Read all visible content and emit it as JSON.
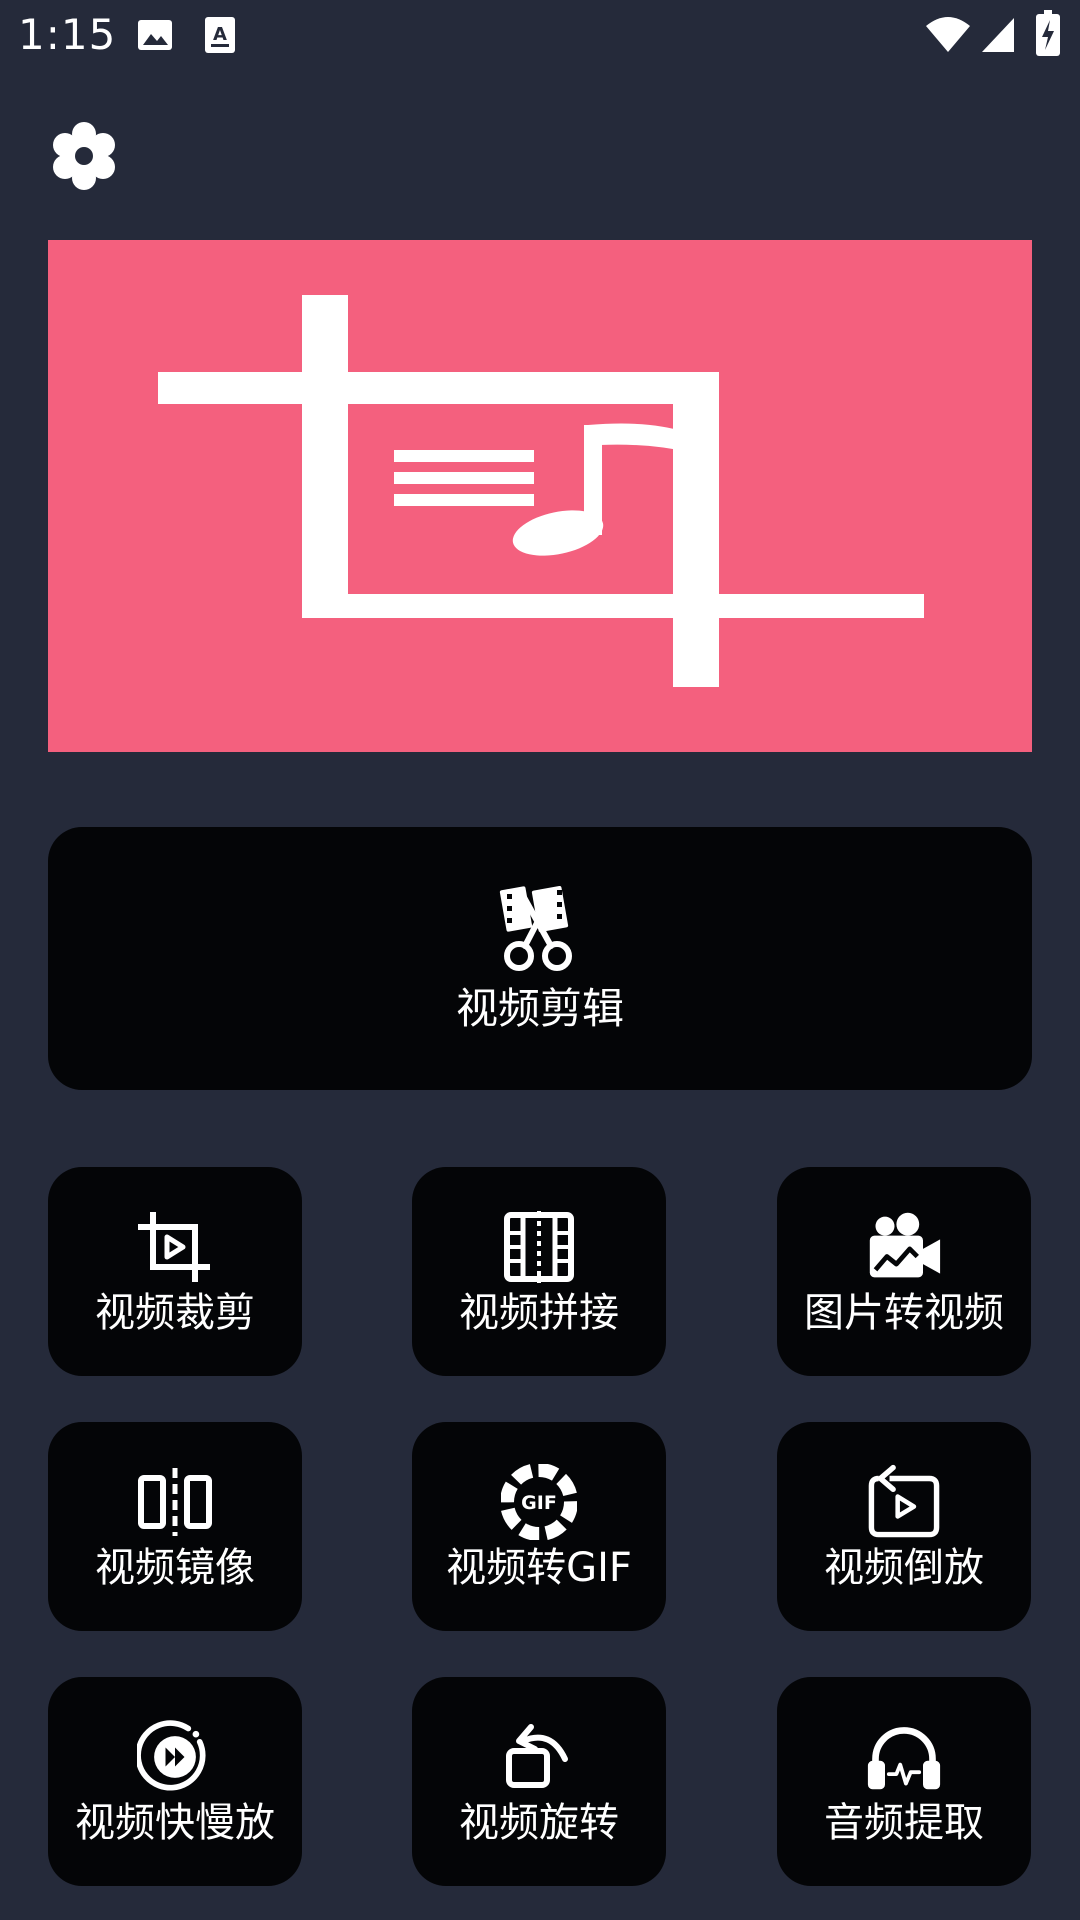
{
  "status_bar": {
    "time": "1:15",
    "icons": [
      "image-icon",
      "accessibility-app-icon",
      "wifi-icon",
      "signal-icon",
      "battery-charging-icon"
    ]
  },
  "header": {
    "settings_icon": "gear-icon"
  },
  "banner": {
    "color": "#f4607e",
    "icon": "crop-music-icon"
  },
  "main": {
    "big_tool": {
      "label": "视频剪辑",
      "icon": "film-scissors-icon"
    },
    "tools": [
      {
        "label": "视频裁剪",
        "icon": "crop-play-icon"
      },
      {
        "label": "视频拼接",
        "icon": "film-join-icon"
      },
      {
        "label": "图片转视频",
        "icon": "picture-camera-icon"
      },
      {
        "label": "视频镜像",
        "icon": "mirror-icon"
      },
      {
        "label": "视频转GIF",
        "icon": "gif-icon"
      },
      {
        "label": "视频倒放",
        "icon": "reverse-play-icon"
      },
      {
        "label": "视频快慢放",
        "icon": "fast-forward-icon"
      },
      {
        "label": "视频旋转",
        "icon": "rotate-icon"
      },
      {
        "label": "音频提取",
        "icon": "headphones-icon"
      }
    ]
  },
  "colors": {
    "background": "#252a3a",
    "card": "#040507",
    "banner": "#f4607e"
  }
}
